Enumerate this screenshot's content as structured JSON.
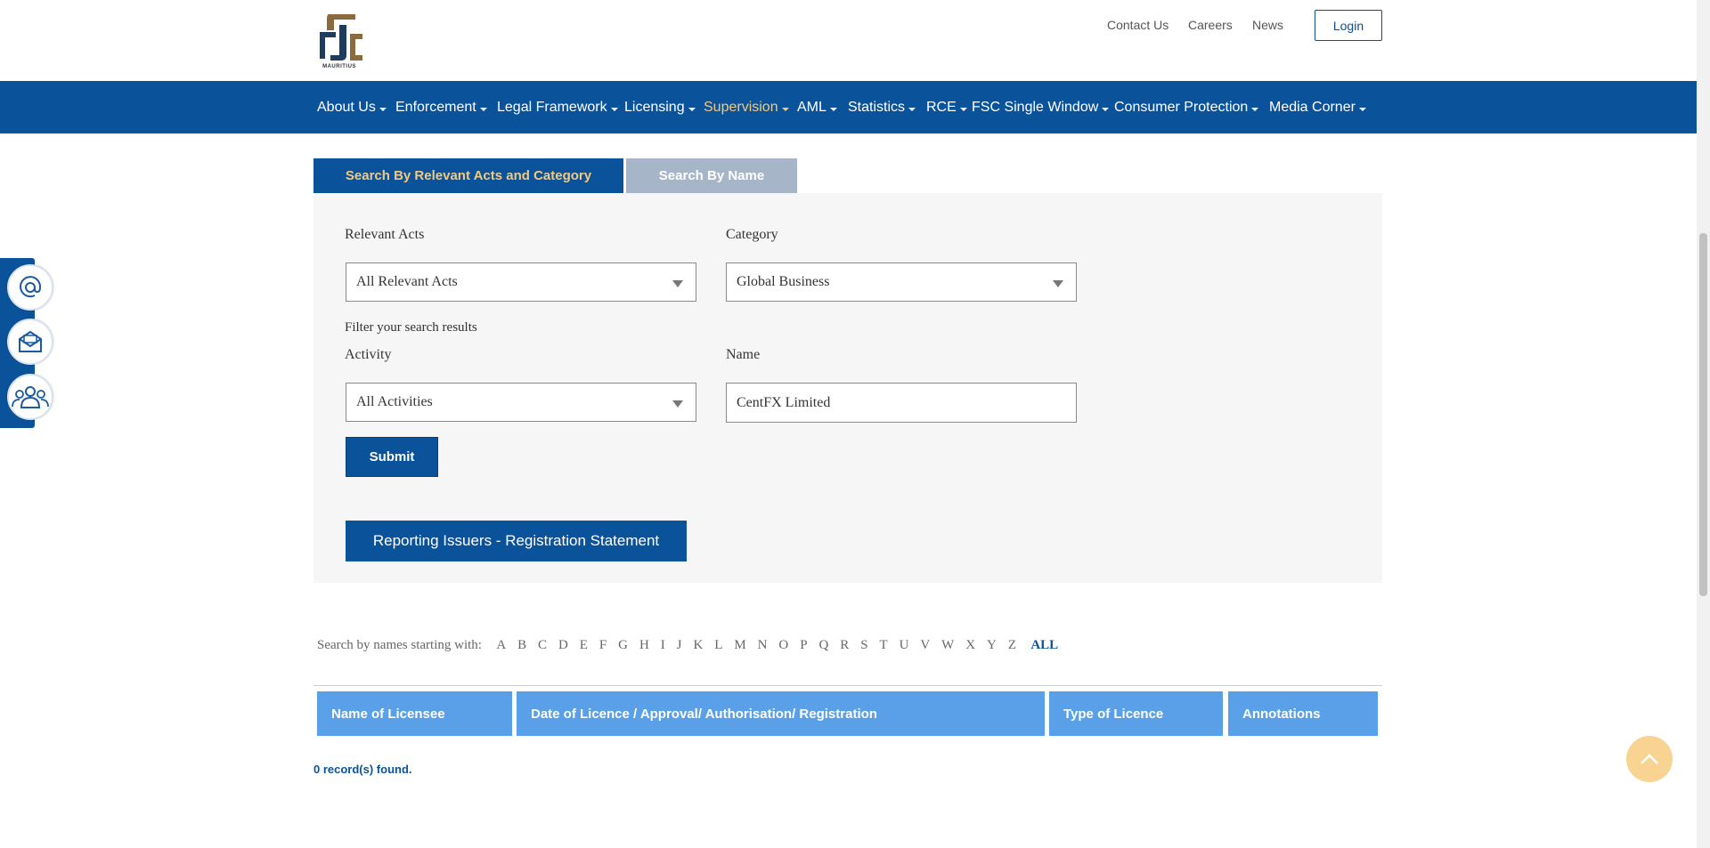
{
  "header": {
    "logo_text": "MAURITIUS",
    "links": [
      "Contact Us",
      "Careers",
      "News"
    ],
    "login_label": "Login"
  },
  "nav": {
    "items": [
      {
        "label": "About Us",
        "active": false
      },
      {
        "label": "Enforcement",
        "active": false
      },
      {
        "label": "Legal Framework",
        "active": false
      },
      {
        "label": "Licensing",
        "active": false
      },
      {
        "label": "Supervision",
        "active": true
      },
      {
        "label": "AML",
        "active": false
      },
      {
        "label": "Statistics",
        "active": false
      },
      {
        "label": "RCE",
        "active": false
      },
      {
        "label": "FSC Single Window",
        "active": false
      },
      {
        "label": "Consumer Protection",
        "active": false
      },
      {
        "label": "Media Corner",
        "active": false
      }
    ]
  },
  "tabs": {
    "tab1": "Search By Relevant Acts and Category",
    "tab2": "Search By Name"
  },
  "form": {
    "relevant_acts_label": "Relevant Acts",
    "relevant_acts_value": "All Relevant Acts",
    "category_label": "Category",
    "category_value": "Global Business",
    "filter_text": "Filter your search results",
    "activity_label": "Activity",
    "activity_value": "All Activities",
    "name_label": "Name",
    "name_value": "CentFX Limited",
    "submit_label": "Submit",
    "report_label": "Reporting Issuers - Registration Statement"
  },
  "alphabet": {
    "label": "Search by names starting with:",
    "letters": [
      "A",
      "B",
      "C",
      "D",
      "E",
      "F",
      "G",
      "H",
      "I",
      "J",
      "K",
      "L",
      "M",
      "N",
      "O",
      "P",
      "Q",
      "R",
      "S",
      "T",
      "U",
      "V",
      "W",
      "X",
      "Y",
      "Z"
    ],
    "all_label": "ALL"
  },
  "table": {
    "headers": [
      "Name of Licensee",
      "Date of Licence / Approval/ Authorisation/ Registration",
      "Type of Licence",
      "Annotations"
    ],
    "records_text": "0 record(s) found."
  },
  "colors": {
    "nav_blue": "#0a539b",
    "accent_gold": "#f2c97e",
    "header_blue": "#59a0e8"
  },
  "icons": {
    "side": [
      "at-icon",
      "envelope-icon",
      "people-icon"
    ],
    "back_to_top": "chevron-up-icon"
  }
}
